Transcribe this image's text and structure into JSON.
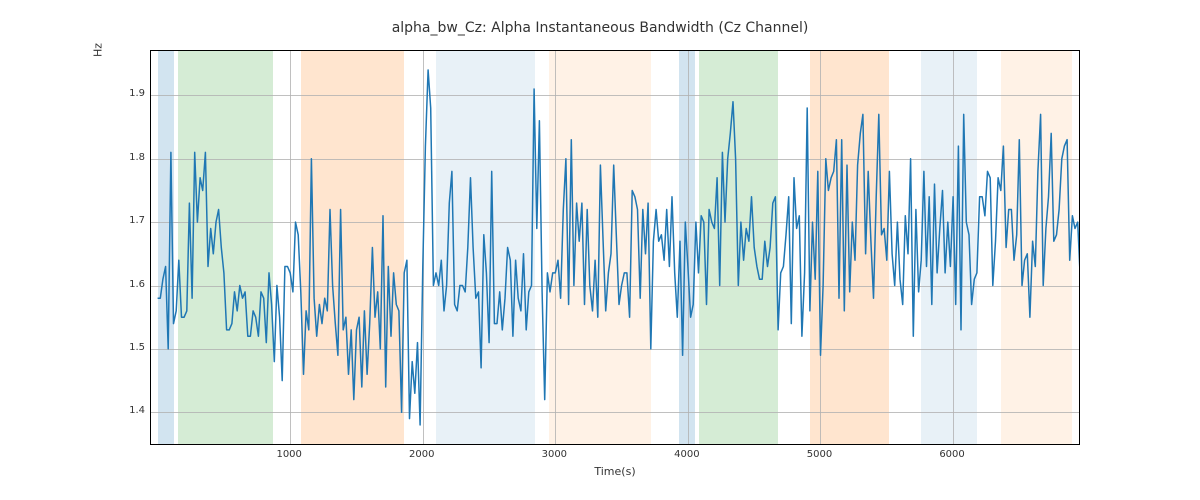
{
  "chart_data": {
    "type": "line",
    "title": "alpha_bw_Cz: Alpha Instantaneous Bandwidth (Cz Channel)",
    "xlabel": "Time(s)",
    "ylabel": "Hz",
    "xlim": [
      -50,
      6950
    ],
    "ylim": [
      1.35,
      1.97
    ],
    "xticks": [
      1000,
      2000,
      3000,
      4000,
      5000,
      6000
    ],
    "yticks": [
      1.4,
      1.5,
      1.6,
      1.7,
      1.8,
      1.9
    ],
    "line_color": "#1f77b4",
    "spans": [
      {
        "start": 0,
        "end": 120,
        "color": "#1f77b4",
        "alpha": 0.2
      },
      {
        "start": 150,
        "end": 870,
        "color": "#2ca02c",
        "alpha": 0.2
      },
      {
        "start": 1080,
        "end": 1860,
        "color": "#ff7f0e",
        "alpha": 0.2
      },
      {
        "start": 2100,
        "end": 2850,
        "color": "#1f77b4",
        "alpha": 0.1
      },
      {
        "start": 2950,
        "end": 3720,
        "color": "#ff7f0e",
        "alpha": 0.1
      },
      {
        "start": 3930,
        "end": 4050,
        "color": "#1f77b4",
        "alpha": 0.2
      },
      {
        "start": 4080,
        "end": 4680,
        "color": "#2ca02c",
        "alpha": 0.2
      },
      {
        "start": 4920,
        "end": 5520,
        "color": "#ff7f0e",
        "alpha": 0.2
      },
      {
        "start": 5760,
        "end": 6180,
        "color": "#1f77b4",
        "alpha": 0.1
      },
      {
        "start": 6360,
        "end": 6900,
        "color": "#ff7f0e",
        "alpha": 0.1
      }
    ],
    "x_step": 20,
    "values": [
      1.58,
      1.58,
      1.61,
      1.63,
      1.5,
      1.81,
      1.54,
      1.56,
      1.64,
      1.55,
      1.55,
      1.56,
      1.73,
      1.58,
      1.81,
      1.7,
      1.77,
      1.75,
      1.81,
      1.63,
      1.69,
      1.65,
      1.7,
      1.72,
      1.66,
      1.62,
      1.53,
      1.53,
      1.54,
      1.59,
      1.56,
      1.6,
      1.58,
      1.59,
      1.52,
      1.52,
      1.56,
      1.55,
      1.52,
      1.59,
      1.58,
      1.51,
      1.62,
      1.57,
      1.48,
      1.6,
      1.55,
      1.45,
      1.63,
      1.63,
      1.62,
      1.59,
      1.7,
      1.68,
      1.59,
      1.46,
      1.56,
      1.53,
      1.8,
      1.58,
      1.52,
      1.57,
      1.54,
      1.58,
      1.56,
      1.72,
      1.6,
      1.54,
      1.49,
      1.72,
      1.53,
      1.55,
      1.46,
      1.53,
      1.42,
      1.53,
      1.55,
      1.44,
      1.56,
      1.46,
      1.54,
      1.66,
      1.55,
      1.59,
      1.5,
      1.71,
      1.44,
      1.63,
      1.52,
      1.62,
      1.57,
      1.56,
      1.4,
      1.62,
      1.64,
      1.39,
      1.48,
      1.43,
      1.51,
      1.38,
      1.63,
      1.82,
      1.94,
      1.88,
      1.6,
      1.62,
      1.6,
      1.64,
      1.56,
      1.6,
      1.73,
      1.78,
      1.57,
      1.56,
      1.6,
      1.6,
      1.59,
      1.66,
      1.77,
      1.66,
      1.58,
      1.59,
      1.47,
      1.68,
      1.62,
      1.51,
      1.78,
      1.54,
      1.54,
      1.59,
      1.53,
      1.58,
      1.66,
      1.64,
      1.52,
      1.64,
      1.58,
      1.56,
      1.65,
      1.53,
      1.59,
      1.6,
      1.91,
      1.69,
      1.86,
      1.59,
      1.42,
      1.62,
      1.59,
      1.62,
      1.62,
      1.64,
      1.58,
      1.72,
      1.8,
      1.57,
      1.83,
      1.6,
      1.73,
      1.67,
      1.73,
      1.57,
      1.72,
      1.6,
      1.56,
      1.64,
      1.55,
      1.79,
      1.67,
      1.56,
      1.62,
      1.65,
      1.79,
      1.68,
      1.57,
      1.6,
      1.62,
      1.62,
      1.55,
      1.75,
      1.74,
      1.72,
      1.58,
      1.72,
      1.65,
      1.73,
      1.5,
      1.67,
      1.72,
      1.67,
      1.68,
      1.64,
      1.72,
      1.63,
      1.74,
      1.62,
      1.55,
      1.67,
      1.49,
      1.7,
      1.63,
      1.55,
      1.57,
      1.7,
      1.62,
      1.71,
      1.7,
      1.57,
      1.72,
      1.7,
      1.69,
      1.77,
      1.6,
      1.81,
      1.7,
      1.8,
      1.84,
      1.89,
      1.8,
      1.6,
      1.7,
      1.64,
      1.69,
      1.67,
      1.74,
      1.66,
      1.63,
      1.61,
      1.61,
      1.67,
      1.63,
      1.66,
      1.73,
      1.74,
      1.53,
      1.62,
      1.63,
      1.68,
      1.74,
      1.54,
      1.77,
      1.69,
      1.71,
      1.52,
      1.62,
      1.88,
      1.56,
      1.7,
      1.61,
      1.78,
      1.49,
      1.6,
      1.8,
      1.75,
      1.77,
      1.78,
      1.83,
      1.58,
      1.83,
      1.56,
      1.79,
      1.59,
      1.7,
      1.64,
      1.79,
      1.84,
      1.87,
      1.65,
      1.78,
      1.67,
      1.58,
      1.74,
      1.87,
      1.68,
      1.69,
      1.64,
      1.78,
      1.65,
      1.6,
      1.7,
      1.61,
      1.57,
      1.71,
      1.65,
      1.8,
      1.52,
      1.72,
      1.59,
      1.64,
      1.78,
      1.63,
      1.74,
      1.57,
      1.76,
      1.62,
      1.69,
      1.75,
      1.62,
      1.7,
      1.63,
      1.74,
      1.57,
      1.82,
      1.53,
      1.87,
      1.7,
      1.68,
      1.57,
      1.61,
      1.62,
      1.74,
      1.74,
      1.71,
      1.78,
      1.77,
      1.6,
      1.67,
      1.77,
      1.75,
      1.82,
      1.66,
      1.72,
      1.72,
      1.64,
      1.68,
      1.83,
      1.6,
      1.64,
      1.65,
      1.55,
      1.67,
      1.63,
      1.78,
      1.87,
      1.6,
      1.69,
      1.74,
      1.84,
      1.67,
      1.68,
      1.72,
      1.8,
      1.82,
      1.83,
      1.64,
      1.71,
      1.69,
      1.7,
      1.61,
      1.62
    ]
  }
}
